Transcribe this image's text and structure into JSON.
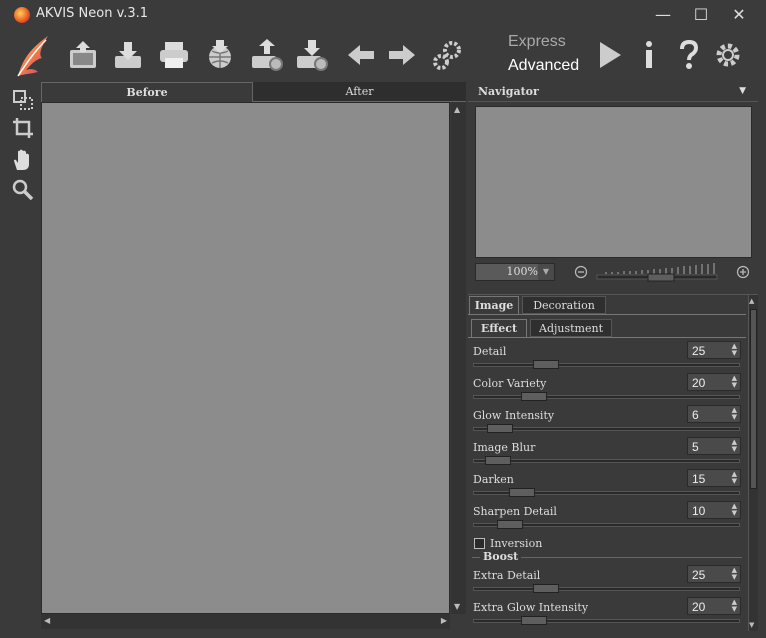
{
  "window": {
    "title": "AKVIS Neon v.3.1",
    "minimize": "—",
    "maximize": "☐",
    "close": "✕"
  },
  "toolbar": {
    "icons": [
      "home-icon",
      "open-icon",
      "print-icon",
      "share-icon",
      "export-icon",
      "import-icon",
      "undo-icon",
      "redo-icon",
      "batch-settings-icon"
    ],
    "mode_express": "Express",
    "mode_advanced": "Advanced",
    "right_icons": [
      "run-icon",
      "info-icon",
      "help-icon",
      "preferences-icon"
    ]
  },
  "left_tools": [
    "before-after-tool-icon",
    "crop-tool-icon",
    "hand-tool-icon",
    "zoom-tool-icon"
  ],
  "view_tabs": {
    "before": "Before",
    "after": "After"
  },
  "navigator": {
    "title": "Navigator",
    "zoom": "100%"
  },
  "settings": {
    "tabs": {
      "image": "Image",
      "decoration": "Decoration"
    },
    "subtabs": {
      "effect": "Effect",
      "adjustment": "Adjustment"
    },
    "params": [
      {
        "label": "Detail",
        "value": "25",
        "pos": 0.25
      },
      {
        "label": "Color Variety",
        "value": "20",
        "pos": 0.2
      },
      {
        "label": "Glow Intensity",
        "value": "6",
        "pos": 0.06
      },
      {
        "label": "Image Blur",
        "value": "5",
        "pos": 0.05
      },
      {
        "label": "Darken",
        "value": "15",
        "pos": 0.15
      },
      {
        "label": "Sharpen Detail",
        "value": "10",
        "pos": 0.1
      }
    ],
    "inversion_label": "Inversion",
    "boost_title": "Boost",
    "boost_params": [
      {
        "label": "Extra Detail",
        "value": "25",
        "pos": 0.25
      },
      {
        "label": "Extra Glow Intensity",
        "value": "20",
        "pos": 0.2
      }
    ]
  },
  "colors": {
    "accent": "#e8542a",
    "canvas": "#8c8c8c",
    "panel": "#3a3a3a"
  }
}
